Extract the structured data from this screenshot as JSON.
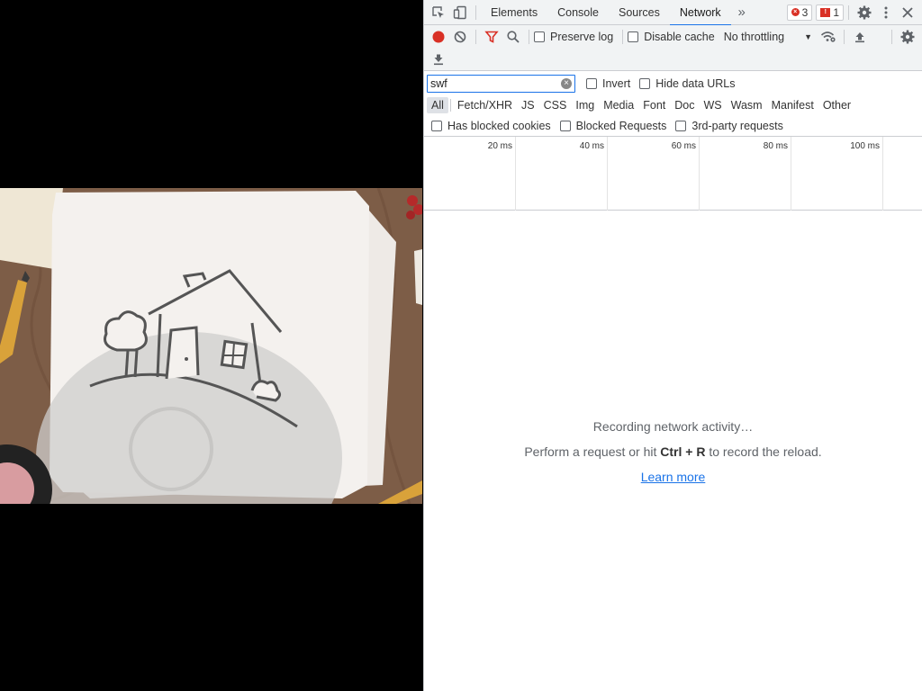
{
  "devtools": {
    "tabs": [
      {
        "label": "Elements"
      },
      {
        "label": "Console"
      },
      {
        "label": "Sources"
      },
      {
        "label": "Network"
      }
    ],
    "active_tab": "Network",
    "overflow_label": "»",
    "errors_count": "3",
    "issues_count": "1"
  },
  "toolbar": {
    "preserve_log_label": "Preserve log",
    "disable_cache_label": "Disable cache",
    "throttling_label": "No throttling",
    "throttling_caret": "▼"
  },
  "filter": {
    "value": "swf",
    "invert_label": "Invert",
    "hide_data_urls_label": "Hide data URLs"
  },
  "types": [
    "All",
    "Fetch/XHR",
    "JS",
    "CSS",
    "Img",
    "Media",
    "Font",
    "Doc",
    "WS",
    "Wasm",
    "Manifest",
    "Other"
  ],
  "blocked": {
    "has_blocked_cookies_label": "Has blocked cookies",
    "blocked_requests_label": "Blocked Requests",
    "third_party_label": "3rd-party requests"
  },
  "timeline": {
    "ticks": [
      "20 ms",
      "40 ms",
      "60 ms",
      "80 ms",
      "100 ms"
    ]
  },
  "empty_state": {
    "recording": "Recording network activity…",
    "perform_prefix": "Perform a request or hit ",
    "shortcut": "Ctrl + R",
    "perform_suffix": " to record the reload.",
    "learn_more": "Learn more"
  },
  "colors": {
    "record": "#d93025",
    "filter_active": "#d93025",
    "accent": "#1a73e8"
  }
}
